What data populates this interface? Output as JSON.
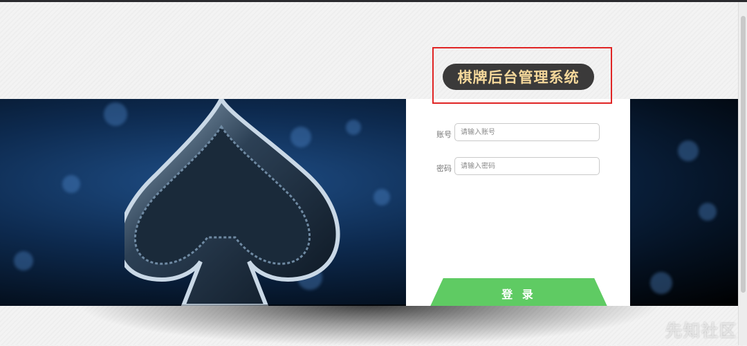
{
  "title": "棋牌后台管理系统",
  "form": {
    "account_label": "账号",
    "account_placeholder": "请输入账号",
    "account_value": "",
    "password_label": "密码",
    "password_placeholder": "请输入密码",
    "password_value": "",
    "submit_label": "登 录"
  },
  "watermark": "先知社区",
  "colors": {
    "accent_green": "#5fcb63",
    "title_text": "#f5d89b",
    "title_pill_bg": "#3b3a3a",
    "highlight_box": "#e02424"
  },
  "icons": {
    "banner": "spade-icon"
  }
}
